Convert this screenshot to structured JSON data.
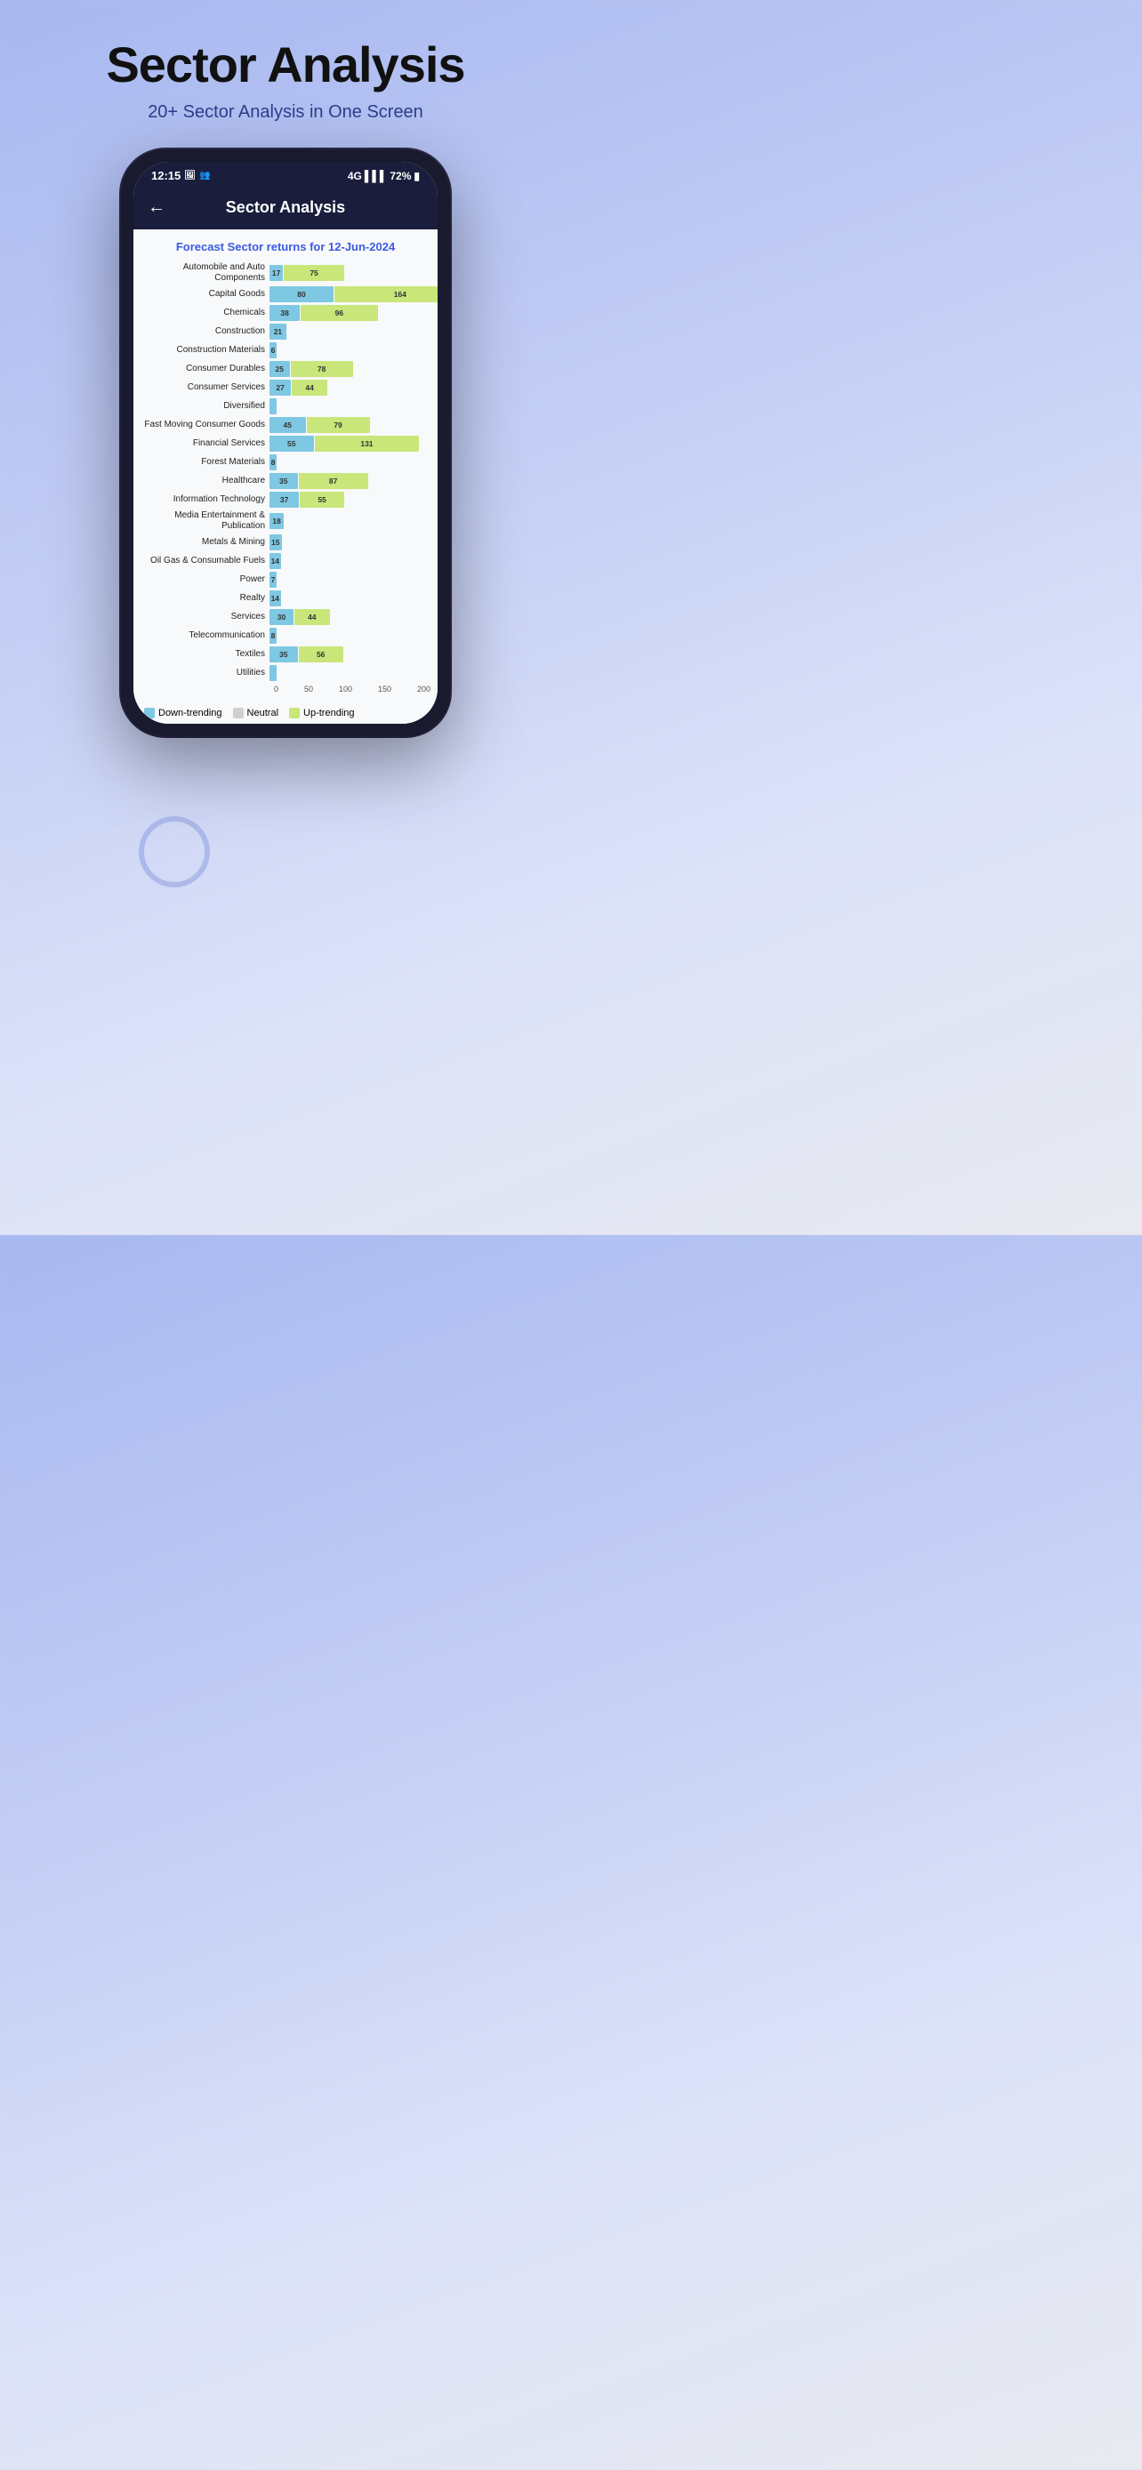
{
  "page": {
    "title": "Sector Analysis",
    "subtitle": "20+ Sector Analysis in One Screen"
  },
  "status_bar": {
    "time": "12:15",
    "battery": "72%"
  },
  "app_header": {
    "title": "Sector Analysis",
    "back_label": "←"
  },
  "chart": {
    "title": "Forecast Sector returns for 12-Jun-2024",
    "x_axis_labels": [
      "0",
      "50",
      "100",
      "150",
      "200"
    ],
    "scale_max": 200,
    "rows": [
      {
        "label": "Automobile and Auto Components",
        "blue": 17,
        "green": 75
      },
      {
        "label": "Capital Goods",
        "blue": 80,
        "green": 164
      },
      {
        "label": "Chemicals",
        "blue": 38,
        "green": 96
      },
      {
        "label": "Construction",
        "blue": 21,
        "green": 0
      },
      {
        "label": "Construction Materials",
        "blue": 6,
        "green": 0
      },
      {
        "label": "Consumer Durables",
        "blue": 25,
        "green": 78
      },
      {
        "label": "Consumer Services",
        "blue": 27,
        "green": 44
      },
      {
        "label": "Diversified",
        "blue": 3,
        "green": 0
      },
      {
        "label": "Fast Moving Consumer Goods",
        "blue": 45,
        "green": 79
      },
      {
        "label": "Financial Services",
        "blue": 55,
        "green": 131
      },
      {
        "label": "Forest Materials",
        "blue": 8,
        "green": 0
      },
      {
        "label": "Healthcare",
        "blue": 35,
        "green": 87
      },
      {
        "label": "Information Technology",
        "blue": 37,
        "green": 55
      },
      {
        "label": "Media Entertainment & Publication",
        "blue": 18,
        "green": 0
      },
      {
        "label": "Metals & Mining",
        "blue": 15,
        "green": 0
      },
      {
        "label": "Oil Gas & Consumable Fuels",
        "blue": 14,
        "green": 0
      },
      {
        "label": "Power",
        "blue": 7,
        "green": 0
      },
      {
        "label": "Realty",
        "blue": 14,
        "green": 0
      },
      {
        "label": "Services",
        "blue": 30,
        "green": 44
      },
      {
        "label": "Telecommunication",
        "blue": 8,
        "green": 0
      },
      {
        "label": "Textiles",
        "blue": 35,
        "green": 56
      },
      {
        "label": "Utilities",
        "blue": 2,
        "green": 0
      }
    ]
  },
  "legend": {
    "items": [
      {
        "key": "down-trending",
        "label": "Down-trending",
        "color": "#7ec8e3"
      },
      {
        "key": "neutral",
        "label": "Neutral",
        "color": "#d0d0d0"
      },
      {
        "key": "up-trending",
        "label": "Up-trending",
        "color": "#c8e67a"
      }
    ]
  }
}
